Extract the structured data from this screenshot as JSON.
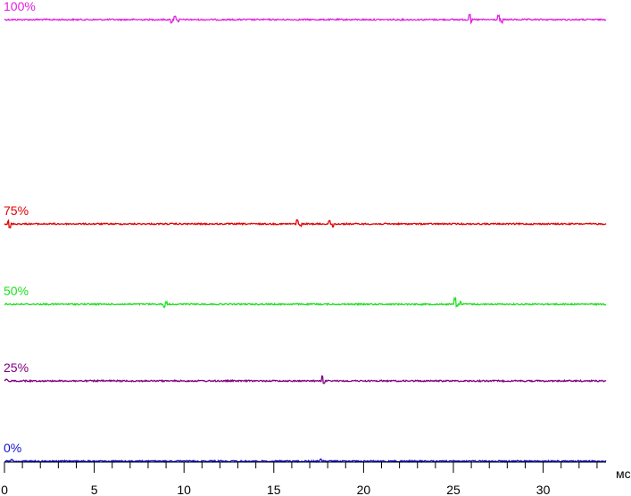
{
  "chart_data": {
    "type": "line",
    "title": "",
    "xlabel": "мс",
    "ylabel": "",
    "xlim": [
      0,
      33.5
    ],
    "ylim": [
      0,
      100
    ],
    "x_ticks": [
      0,
      5,
      10,
      15,
      20,
      25,
      30
    ],
    "x_tick_labels": [
      "0",
      "5",
      "10",
      "15",
      "20",
      "25",
      "30"
    ],
    "x_minor_step": 1,
    "grid": false,
    "legend": "none",
    "series": [
      {
        "name": "100%",
        "level": 100,
        "color": "#e020e0",
        "spikes": [
          [
            9.3,
            -3
          ],
          [
            9.5,
            4
          ],
          [
            9.7,
            -2
          ],
          [
            25.9,
            6
          ],
          [
            26.0,
            -3
          ],
          [
            27.5,
            4
          ],
          [
            27.7,
            -3
          ]
        ]
      },
      {
        "name": "75%",
        "level": 75,
        "color": "#e00000",
        "spikes": [
          [
            0.2,
            3
          ],
          [
            0.3,
            -4
          ],
          [
            16.3,
            4
          ],
          [
            16.5,
            -2
          ],
          [
            18.1,
            3
          ],
          [
            18.3,
            -3
          ]
        ]
      },
      {
        "name": "50%",
        "level": 50,
        "color": "#20e020",
        "spikes": [
          [
            8.9,
            -3
          ],
          [
            9.0,
            2
          ],
          [
            25.1,
            6
          ],
          [
            25.2,
            -2
          ],
          [
            25.4,
            3
          ]
        ]
      },
      {
        "name": "25%",
        "level": 25,
        "color": "#800080",
        "spikes": [
          [
            0.1,
            2
          ],
          [
            17.7,
            5
          ],
          [
            17.8,
            -3
          ]
        ]
      },
      {
        "name": "0%",
        "level": 0,
        "color": "#1010d0",
        "spikes": [
          [
            0.4,
            2
          ],
          [
            17.6,
            2
          ]
        ]
      }
    ]
  }
}
